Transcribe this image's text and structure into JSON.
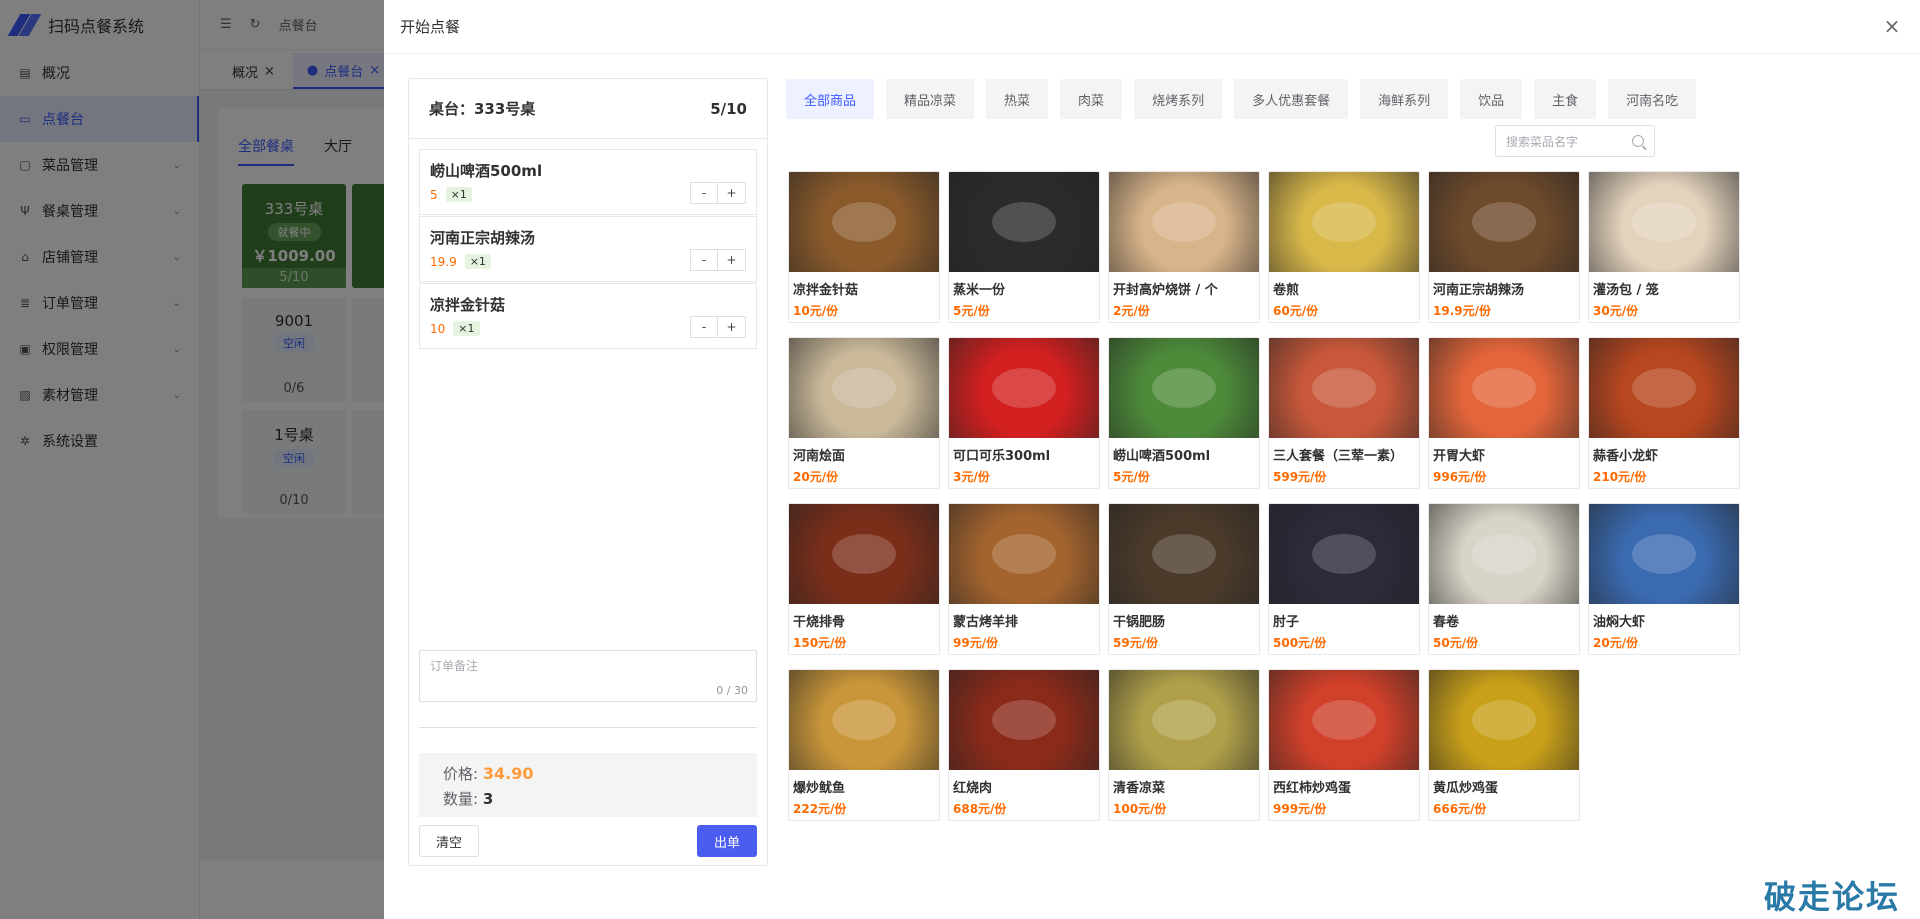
{
  "app": {
    "title": "扫码点餐系统",
    "menu": [
      {
        "label": "概况",
        "icon": "overview-icon",
        "has_children": false
      },
      {
        "label": "点餐台",
        "icon": "monitor-icon",
        "has_children": false,
        "active": true
      },
      {
        "label": "菜品管理",
        "icon": "chat-icon",
        "has_children": true
      },
      {
        "label": "餐桌管理",
        "icon": "fork-icon",
        "has_children": true
      },
      {
        "label": "店铺管理",
        "icon": "store-icon",
        "has_children": true
      },
      {
        "label": "订单管理",
        "icon": "list-icon",
        "has_children": true
      },
      {
        "label": "权限管理",
        "icon": "lock-icon",
        "has_children": true
      },
      {
        "label": "素材管理",
        "icon": "image-icon",
        "has_children": true
      },
      {
        "label": "系统设置",
        "icon": "gear-icon",
        "has_children": false
      }
    ],
    "breadcrumb": "点餐台",
    "tabs": [
      {
        "label": "概况"
      },
      {
        "label": "点餐台",
        "active": true
      }
    ],
    "main_tabs": [
      "全部餐桌",
      "大厅"
    ],
    "tables": [
      {
        "name": "333号桌",
        "status": "就餐中",
        "amount": "￥1009.00",
        "count": "5/10",
        "busy": true
      },
      {
        "name": "9001",
        "status": "空闲",
        "count": "0/6",
        "busy": false
      },
      {
        "name": "1号桌",
        "status": "空闲",
        "count": "0/10",
        "busy": false
      }
    ]
  },
  "drawer": {
    "title": "开始点餐",
    "close_icon": "close-icon"
  },
  "order": {
    "table_label": "桌台：333号桌",
    "seats": "5/10",
    "items": [
      {
        "name": "崂山啤酒500ml",
        "price": "5",
        "qty": "×1"
      },
      {
        "name": "河南正宗胡辣汤",
        "price": "19.9",
        "qty": "×1"
      },
      {
        "name": "凉拌金针菇",
        "price": "10",
        "qty": "×1"
      }
    ],
    "stepper_minus": "-",
    "stepper_plus": "+",
    "remark_placeholder": "订单备注",
    "remark_count": "0 / 30",
    "price_label": "价格:",
    "price_value": "34.90",
    "count_label": "数量:",
    "count_value": "3",
    "clear_label": "清空",
    "submit_label": "出单"
  },
  "categories": [
    "全部商品",
    "精品凉菜",
    "热菜",
    "肉菜",
    "烧烤系列",
    "多人优惠套餐",
    "海鲜系列",
    "饮品",
    "主食",
    "河南名吃"
  ],
  "active_category": "全部商品",
  "search": {
    "placeholder": "搜索菜品名字"
  },
  "products": [
    {
      "name": "凉拌金针菇",
      "price": "10元/份",
      "color": "#8a5a2b"
    },
    {
      "name": "蒸米一份",
      "price": "5元/份",
      "color": "#2b2b2b"
    },
    {
      "name": "开封高炉烧饼 / 个",
      "price": "2元/份",
      "color": "#d8b48a"
    },
    {
      "name": "卷煎",
      "price": "60元/份",
      "color": "#d9b84a"
    },
    {
      "name": "河南正宗胡辣汤",
      "price": "19.9元/份",
      "color": "#6e4a2c"
    },
    {
      "name": "灌汤包 / 笼",
      "price": "30元/份",
      "color": "#e3d3bd"
    },
    {
      "name": "河南烩面",
      "price": "20元/份",
      "color": "#c9b89a"
    },
    {
      "name": "可口可乐300ml",
      "price": "3元/份",
      "color": "#d32020"
    },
    {
      "name": "崂山啤酒500ml",
      "price": "5元/份",
      "color": "#4d8a3a"
    },
    {
      "name": "三人套餐（三荤一素）",
      "price": "599元/份",
      "color": "#c9583a"
    },
    {
      "name": "开胃大虾",
      "price": "996元/份",
      "color": "#e3653a"
    },
    {
      "name": "蒜香小龙虾",
      "price": "210元/份",
      "color": "#b8461f"
    },
    {
      "name": "干烧排骨",
      "price": "150元/份",
      "color": "#7a2e1a"
    },
    {
      "name": "蒙古烤羊排",
      "price": "99元/份",
      "color": "#a4642e"
    },
    {
      "name": "干锅肥肠",
      "price": "59元/份",
      "color": "#4a3a2a"
    },
    {
      "name": "肘子",
      "price": "500元/份",
      "color": "#2a2a3a"
    },
    {
      "name": "春卷",
      "price": "50元/份",
      "color": "#d9d4c8"
    },
    {
      "name": "油焖大虾",
      "price": "20元/份",
      "color": "#3a6ab0"
    },
    {
      "name": "爆炒鱿鱼",
      "price": "222元/份",
      "color": "#c9963a"
    },
    {
      "name": "红烧肉",
      "price": "688元/份",
      "color": "#8a2a1a"
    },
    {
      "name": "清香凉菜",
      "price": "100元/份",
      "color": "#b0a04a"
    },
    {
      "name": "西红柿炒鸡蛋",
      "price": "999元/份",
      "color": "#d0402a"
    },
    {
      "name": "黄瓜炒鸡蛋",
      "price": "666元/份",
      "color": "#c9a01a"
    }
  ],
  "watermark": "破走论坛"
}
